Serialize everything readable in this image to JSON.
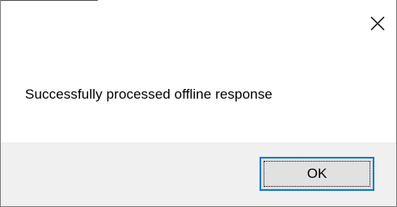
{
  "dialog": {
    "message": "Successfully processed offline response",
    "ok_label": "OK",
    "close_icon": "close-icon",
    "accent_color": "#0078d7",
    "footer_color": "#f0f0f0"
  }
}
